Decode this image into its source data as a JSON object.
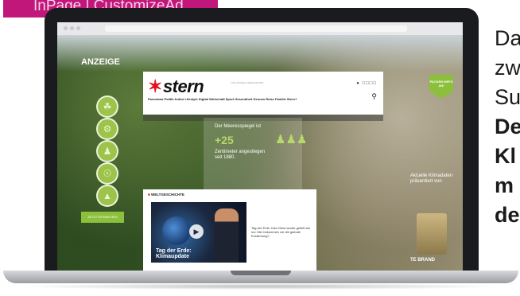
{
  "tag": {
    "label": "InPage | CustomizeAd"
  },
  "ad": {
    "label": "ANZEIGE",
    "cta": "JETZT MITMACHEN",
    "icons": [
      "leaf-icon",
      "factory-icon",
      "people-icon",
      "globe-icon",
      "car-icon"
    ],
    "packen": "PACKEN WIR'S AN!",
    "side_text": "Aktuelle Klimadaten präsentiert von",
    "brand": "TE BRAND"
  },
  "site": {
    "logo": "stern",
    "nav": "Panorama  Politik  Kultur  Lifestyle  Digital  Wirtschaft  Sport  Gesundheit  Genuss  Reise  Familie  Stern+",
    "top_links": "LIVE-TICKER  |  NEWSLETTER",
    "section": "WELTGESCHICHTE",
    "video_caption_1": "Tag der Erde:",
    "video_caption_2": "Klimaupdate",
    "article": "Tag der Erde: Das Klima wurde geteilt wie nur Hier bekommen wir die globale Erwärmung?"
  },
  "badge": {
    "title": "Der Meeresspiegel ist",
    "value": "+25",
    "text": "Zentimeter angestiegen seit 1880."
  },
  "promo": {
    "lines": [
      "Da",
      "zw",
      "Su"
    ],
    "bold_lines": [
      "De",
      "Kl",
      "m",
      "de"
    ]
  },
  "colors": {
    "accent": "#c2177a",
    "green": "#8cbf3c",
    "stern_red": "#e0121b"
  }
}
